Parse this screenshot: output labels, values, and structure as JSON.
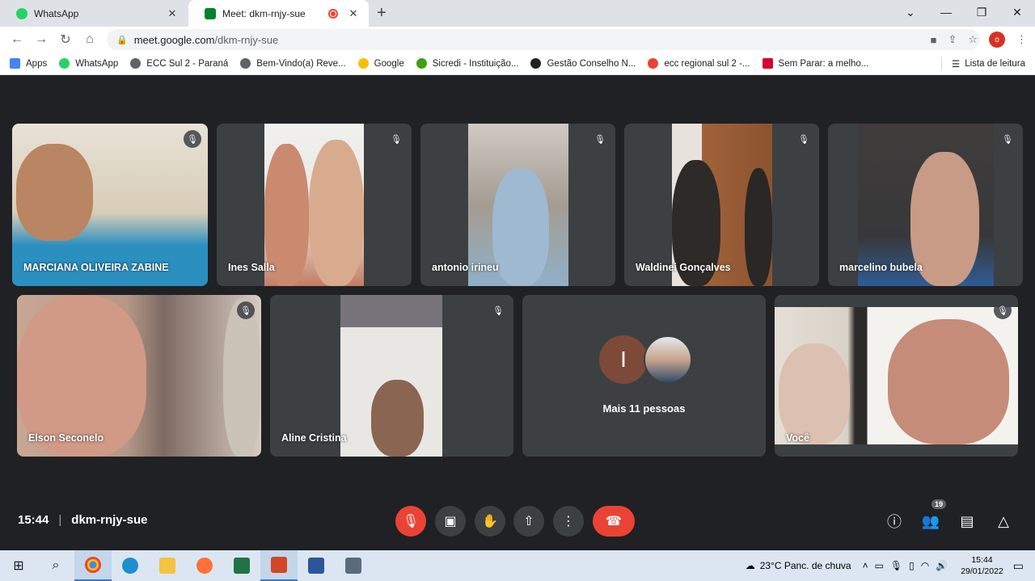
{
  "browser": {
    "tabs": [
      {
        "title": "WhatsApp",
        "color": "#25d366"
      },
      {
        "title": "Meet: dkm-rnjy-sue",
        "color": "#00832d"
      }
    ],
    "url_host": "meet.google.com",
    "url_path": "/dkm-rnjy-sue",
    "profile_initial": "o",
    "bookmarks": [
      {
        "label": "Apps",
        "icon": "apps-grid-icon"
      },
      {
        "label": "WhatsApp",
        "icon": "whatsapp-icon"
      },
      {
        "label": "ECC Sul 2 - Paraná",
        "icon": "globe-icon"
      },
      {
        "label": "Bem-Vindo(a) Reve...",
        "icon": "globe-icon"
      },
      {
        "label": "Google",
        "icon": "google-icon"
      },
      {
        "label": "Sicredi - Instituição...",
        "icon": "sicredi-icon"
      },
      {
        "label": "Gestão Conselho N...",
        "icon": "dark-circle-icon"
      },
      {
        "label": "ecc regional sul 2 -...",
        "icon": "google-icon"
      },
      {
        "label": "Sem Parar: a melho...",
        "icon": "arrow-up-icon"
      }
    ],
    "reading_list": "Lista de leitura"
  },
  "meet": {
    "participants": [
      {
        "name": "MARCIANA OLIVEIRA ZABINE",
        "muted": true
      },
      {
        "name": "Ines Salla",
        "muted": true
      },
      {
        "name": "antonio irineu",
        "muted": true
      },
      {
        "name": "Waldinei Gonçalves",
        "muted": true
      },
      {
        "name": "marcelino bubela",
        "muted": true
      },
      {
        "name": "Elson Seconelo",
        "muted": true
      },
      {
        "name": "Aline Cristina",
        "muted": true
      },
      {
        "name": "Você",
        "muted": true
      }
    ],
    "more_people": {
      "label": "Mais 11 pessoas",
      "avatar_initial": "I"
    },
    "time": "15:44",
    "meeting_code": "dkm-rnjy-sue",
    "people_count": "19"
  },
  "taskbar": {
    "weather": "23°C  Panc. de chuva",
    "time": "15:44",
    "date": "29/01/2022"
  }
}
